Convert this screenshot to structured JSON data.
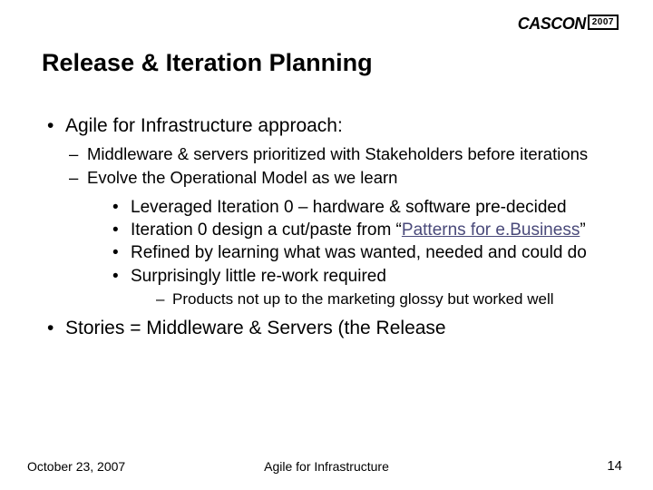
{
  "logo": {
    "brand": "CASCON",
    "year": "2007"
  },
  "title": "Release & Iteration Planning",
  "bullets": {
    "lvl1a": "Agile for Infrastructure approach:",
    "lvl2a": "Middleware & servers prioritized with Stakeholders before iterations",
    "lvl2b": "Evolve the Operational Model as we learn",
    "lvl3a": "Leveraged Iteration 0 – hardware & software pre-decided",
    "lvl3b_pre": "Iteration 0 design a cut/paste from “",
    "lvl3b_link": "Patterns for e.Business",
    "lvl3b_post": "”",
    "lvl3c": "Refined by learning what was wanted, needed and could do",
    "lvl3d": "Surprisingly little re-work required",
    "lvl4a": "Products not up to the marketing glossy but worked well",
    "stories": "Stories = Middleware & Servers (the Release"
  },
  "footer": {
    "date": "October 23, 2007",
    "center": "Agile for Infrastructure",
    "page": "14"
  }
}
